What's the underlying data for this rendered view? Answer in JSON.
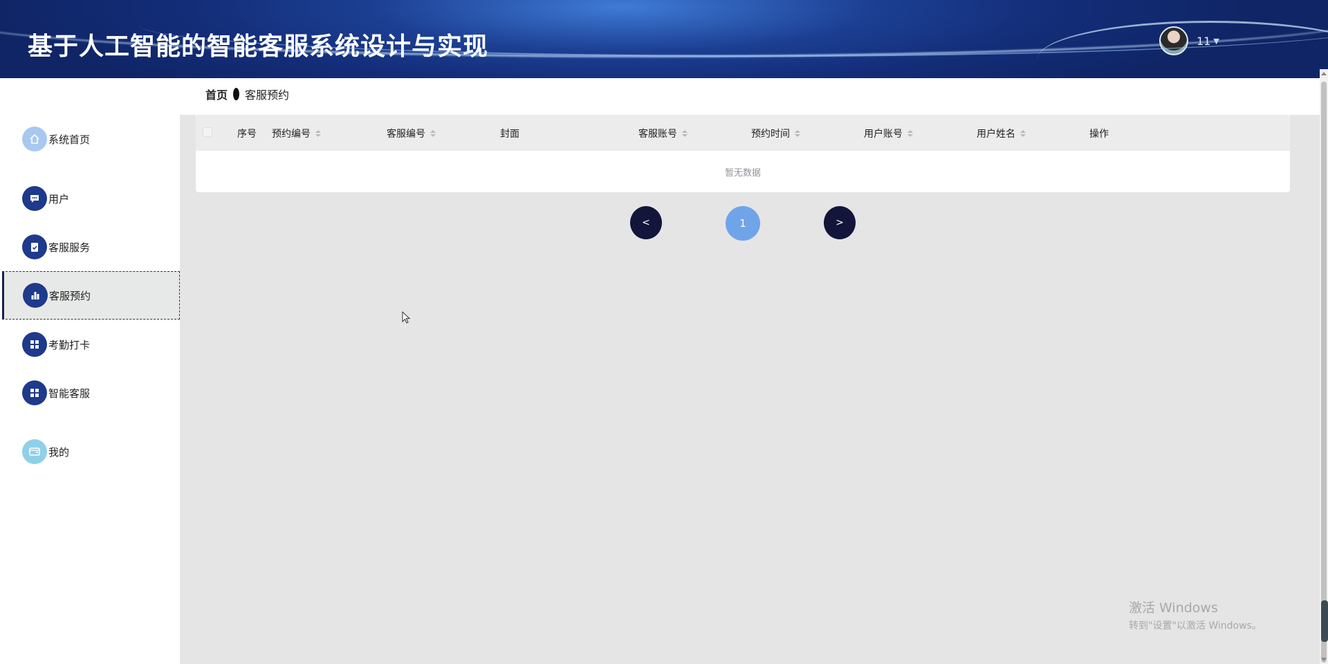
{
  "header": {
    "title": "基于人工智能的智能客服系统设计与实现",
    "username": "11"
  },
  "sidebar": {
    "items": [
      {
        "label": "系统首页",
        "icon": "home-icon"
      },
      {
        "label": "用户",
        "icon": "chat-icon"
      },
      {
        "label": "客服服务",
        "icon": "clipboard-check-icon"
      },
      {
        "label": "客服预约",
        "icon": "bar-chart-icon",
        "active": true
      },
      {
        "label": "考勤打卡",
        "icon": "grid-icon"
      },
      {
        "label": "智能客服",
        "icon": "grid-icon"
      },
      {
        "label": "我的",
        "icon": "wallet-icon"
      }
    ]
  },
  "breadcrumb": {
    "home": "首页",
    "current": "客服预约"
  },
  "table": {
    "columns": [
      "序号",
      "预约编号",
      "客服编号",
      "封面",
      "客服账号",
      "预约时间",
      "用户账号",
      "用户姓名",
      "操作"
    ],
    "empty_text": "暂无数据"
  },
  "pagination": {
    "prev": "<",
    "current_page": "1",
    "next": ">"
  },
  "watermark": {
    "line1": "激活 Windows",
    "line2": "转到\"设置\"以激活 Windows。"
  },
  "colors": {
    "header_bg": "#132d78",
    "nav_icon_bg": "#1e3a8a",
    "page_active": "#6fa5e8",
    "pager_button": "#13153a",
    "content_bg": "#e5e5e5"
  }
}
